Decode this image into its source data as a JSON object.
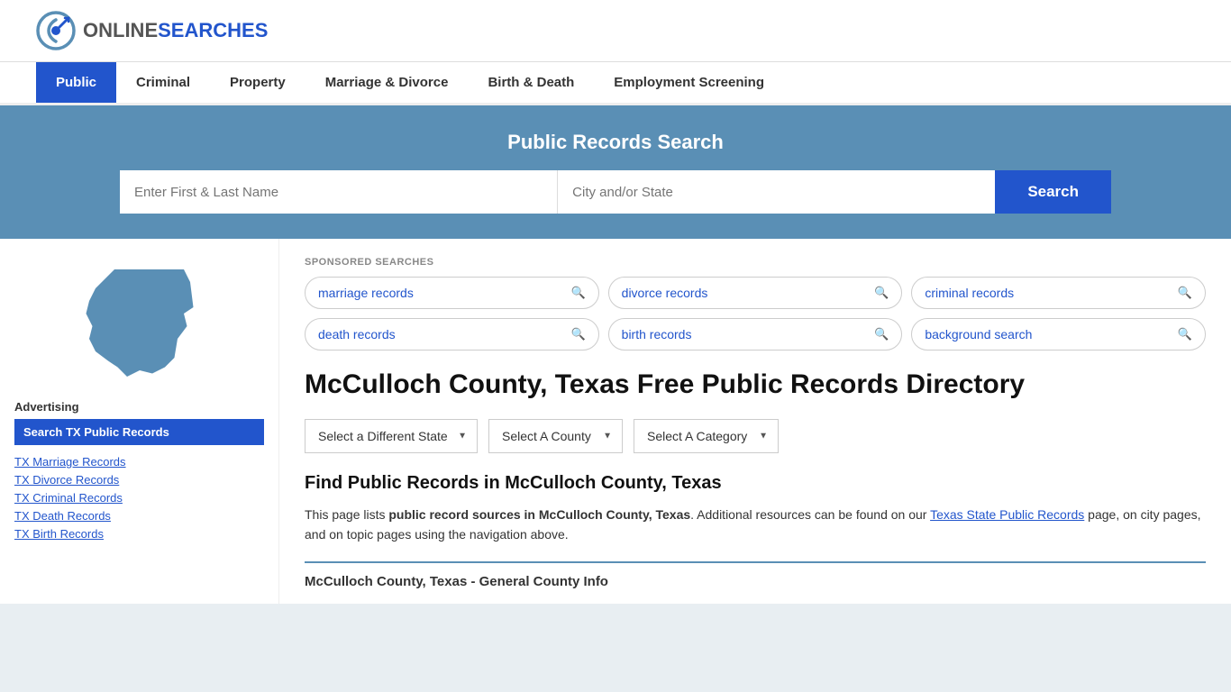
{
  "logo": {
    "online": "ONLINE",
    "searches": "SEARCHES",
    "alt": "OnlineSearches Logo"
  },
  "nav": {
    "items": [
      {
        "label": "Public",
        "active": true
      },
      {
        "label": "Criminal",
        "active": false
      },
      {
        "label": "Property",
        "active": false
      },
      {
        "label": "Marriage & Divorce",
        "active": false
      },
      {
        "label": "Birth & Death",
        "active": false
      },
      {
        "label": "Employment Screening",
        "active": false
      }
    ]
  },
  "search_banner": {
    "title": "Public Records Search",
    "name_placeholder": "Enter First & Last Name",
    "location_placeholder": "City and/or State",
    "button_label": "Search"
  },
  "sponsored": {
    "label": "SPONSORED SEARCHES",
    "pills": [
      {
        "text": "marriage records"
      },
      {
        "text": "divorce records"
      },
      {
        "text": "criminal records"
      },
      {
        "text": "death records"
      },
      {
        "text": "birth records"
      },
      {
        "text": "background search"
      }
    ]
  },
  "county": {
    "title": "McCulloch County, Texas Free Public Records Directory",
    "dropdowns": {
      "state": "Select a Different State",
      "county": "Select A County",
      "category": "Select A Category"
    }
  },
  "find_section": {
    "title": "Find Public Records in McCulloch County, Texas",
    "description_plain": "This page lists ",
    "description_bold": "public record sources in McCulloch County, Texas",
    "description_after": ". Additional resources can be found on our ",
    "link_text": "Texas State Public Records",
    "description_end": " page, on city pages, and on topic pages using the navigation above."
  },
  "general_info": {
    "title": "McCulloch County, Texas - General County Info"
  },
  "sidebar": {
    "advertising_label": "Advertising",
    "ad_button": "Search TX Public Records",
    "links": [
      {
        "label": "TX Marriage Records"
      },
      {
        "label": "TX Divorce Records"
      },
      {
        "label": "TX Criminal Records"
      },
      {
        "label": "TX Death Records"
      },
      {
        "label": "TX Birth Records"
      }
    ]
  }
}
